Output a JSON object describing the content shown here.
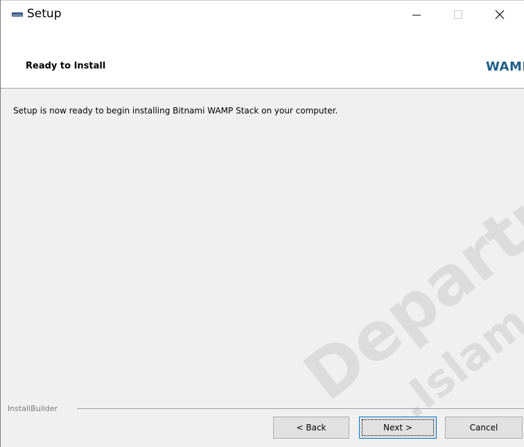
{
  "window": {
    "title": "Setup",
    "app_icon": "wamp-logo-icon",
    "controls": {
      "minimize": "minimize-icon",
      "maximize": "maximize-icon",
      "close": "close-icon"
    }
  },
  "header": {
    "title": "Ready to Install",
    "logo_text": "WAMP"
  },
  "body": {
    "message": "Setup is now ready to begin installing Bitnami WAMP Stack on your computer."
  },
  "watermark": {
    "line1": "Department",
    "line2": "…Islam Uni…"
  },
  "footer": {
    "label": "InstallBuilder",
    "buttons": {
      "back": "< Back",
      "next": "Next >",
      "cancel": "Cancel"
    }
  },
  "colors": {
    "window_bg": "#f0f0f0",
    "header_bg": "#ffffff",
    "logo": "#1f5d86",
    "button_bg": "#e1e1e1",
    "focus_border": "#0078d7"
  }
}
